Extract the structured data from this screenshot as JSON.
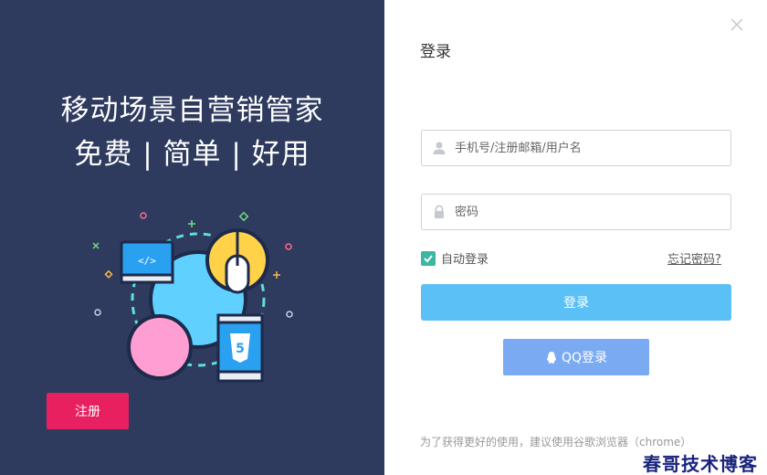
{
  "left_panel": {
    "slogan_line1": "移动场景自营销管家",
    "slogan_line2": "免费 | 简单 | 好用",
    "register_label": "注册",
    "illustration_code_text": "</>",
    "illustration_badge_text": "5"
  },
  "login": {
    "title": "登录",
    "username_placeholder": "手机号/注册邮箱/用户名",
    "password_placeholder": "密码",
    "auto_login_label": "自动登录",
    "auto_login_checked": true,
    "forgot_label": "忘记密码?",
    "login_label": "登录",
    "qq_login_label": "QQ登录",
    "browser_tip": "为了获得更好的使用，建议使用谷歌浏览器（chrome）"
  },
  "icons": {
    "close": "close-icon",
    "user": "user-icon",
    "lock": "lock-icon",
    "check": "check-icon",
    "qq": "qq-icon"
  },
  "colors": {
    "left_bg": "#2e3a5e",
    "register": "#e8205f",
    "login_button": "#5bc0f6",
    "qq_button": "#7aaaf2",
    "checkbox": "#3cb8a0"
  },
  "watermark": "春哥技术博客"
}
